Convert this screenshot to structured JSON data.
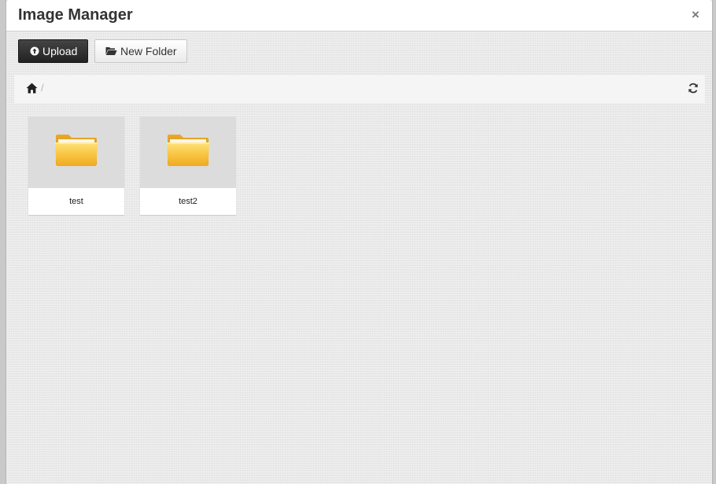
{
  "dialog": {
    "title": "Image Manager",
    "close_label": "×"
  },
  "toolbar": {
    "upload_label": "Upload",
    "new_folder_label": "New Folder"
  },
  "breadcrumb": {
    "separator": "/",
    "home_icon": "home-icon",
    "refresh_icon": "refresh-icon"
  },
  "folders": [
    {
      "name": "test",
      "icon": "folder-icon"
    },
    {
      "name": "test2",
      "icon": "folder-icon"
    }
  ],
  "colors": {
    "upload_button": "#2b2b2b",
    "folder_yellow": "#f0b934",
    "thumb_background": "#dcdcdc"
  }
}
